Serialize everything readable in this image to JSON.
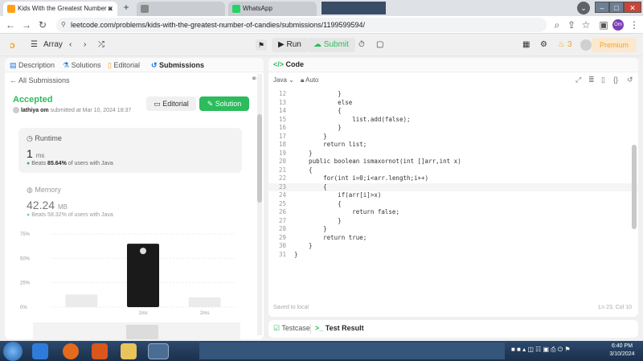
{
  "browser": {
    "tabs": [
      {
        "title": "Kids With the Greatest Number o",
        "active": true
      },
      {
        "title": "",
        "active": false
      },
      {
        "title": "WhatsApp",
        "active": false
      }
    ],
    "url": "leetcode.com/problems/kids-with-the-greatest-number-of-candies/submissions/1199599594/",
    "profile_initials": "Om"
  },
  "header": {
    "problem_list": "Array",
    "run_label": "Run",
    "submit_label": "Submit",
    "streak": "3",
    "premium_label": "Premium"
  },
  "left_tabs": [
    "Description",
    "Solutions",
    "Editorial",
    "Submissions"
  ],
  "submission": {
    "back_label": "All Submissions",
    "status": "Accepted",
    "user": "lathiya om",
    "submitted_text": "submitted at Mar 10, 2024 18:37",
    "editorial_btn": "Editorial",
    "solution_btn": "Solution",
    "runtime": {
      "label": "Runtime",
      "value": "1",
      "unit": "ms",
      "beats_prefix": "Beats",
      "beats_pct": "85.64%",
      "beats_suffix": "of users with Java"
    },
    "memory": {
      "label": "Memory",
      "value": "42.24",
      "unit": "MB",
      "beats_prefix": "Beats",
      "beats_pct": "58.32%",
      "beats_suffix": "of users with Java"
    }
  },
  "chart_data": {
    "type": "bar",
    "y_ticks": [
      "75%",
      "50%",
      "25%",
      "0%"
    ],
    "ylim": [
      0,
      75
    ],
    "categories": [
      "",
      "1ms",
      "2ms"
    ],
    "values": [
      13,
      65,
      10
    ],
    "highlight_index": 1
  },
  "editor": {
    "title": "Code",
    "language": "Java",
    "mode": "Auto",
    "lines": [
      {
        "n": "12",
        "text": "            }"
      },
      {
        "n": "13",
        "text": "            else"
      },
      {
        "n": "14",
        "text": "            {"
      },
      {
        "n": "15",
        "text": "                list.add(false);"
      },
      {
        "n": "16",
        "text": "            }"
      },
      {
        "n": "17",
        "text": "        }"
      },
      {
        "n": "18",
        "text": "        return list;"
      },
      {
        "n": "19",
        "text": "    }"
      },
      {
        "n": "20",
        "text": "    public boolean ismaxornot(int []arr,int x)"
      },
      {
        "n": "21",
        "text": "    {"
      },
      {
        "n": "22",
        "text": "        for(int i=0;i<arr.length;i++)"
      },
      {
        "n": "23",
        "text": "        {"
      },
      {
        "n": "24",
        "text": "            if(arr[i]>x)"
      },
      {
        "n": "25",
        "text": "            {"
      },
      {
        "n": "26",
        "text": "                return false;"
      },
      {
        "n": "27",
        "text": "            }"
      },
      {
        "n": "28",
        "text": "        }"
      },
      {
        "n": "29",
        "text": "        return true;"
      },
      {
        "n": "30",
        "text": "    }"
      },
      {
        "n": "31",
        "text": "}"
      }
    ],
    "highlight_line": "23",
    "saved_label": "Saved to local",
    "cursor_pos": "Ln 23, Col 10"
  },
  "bottom_tabs": [
    "Testcase",
    "Test Result"
  ],
  "taskbar": {
    "time": "6:40 PM",
    "date": "3/10/2024"
  },
  "colors": {
    "accent_green": "#2cbb5d",
    "leetcode_orange": "#ffa116",
    "bar_dark": "#1a1a1a",
    "bar_light": "#ebebeb"
  }
}
